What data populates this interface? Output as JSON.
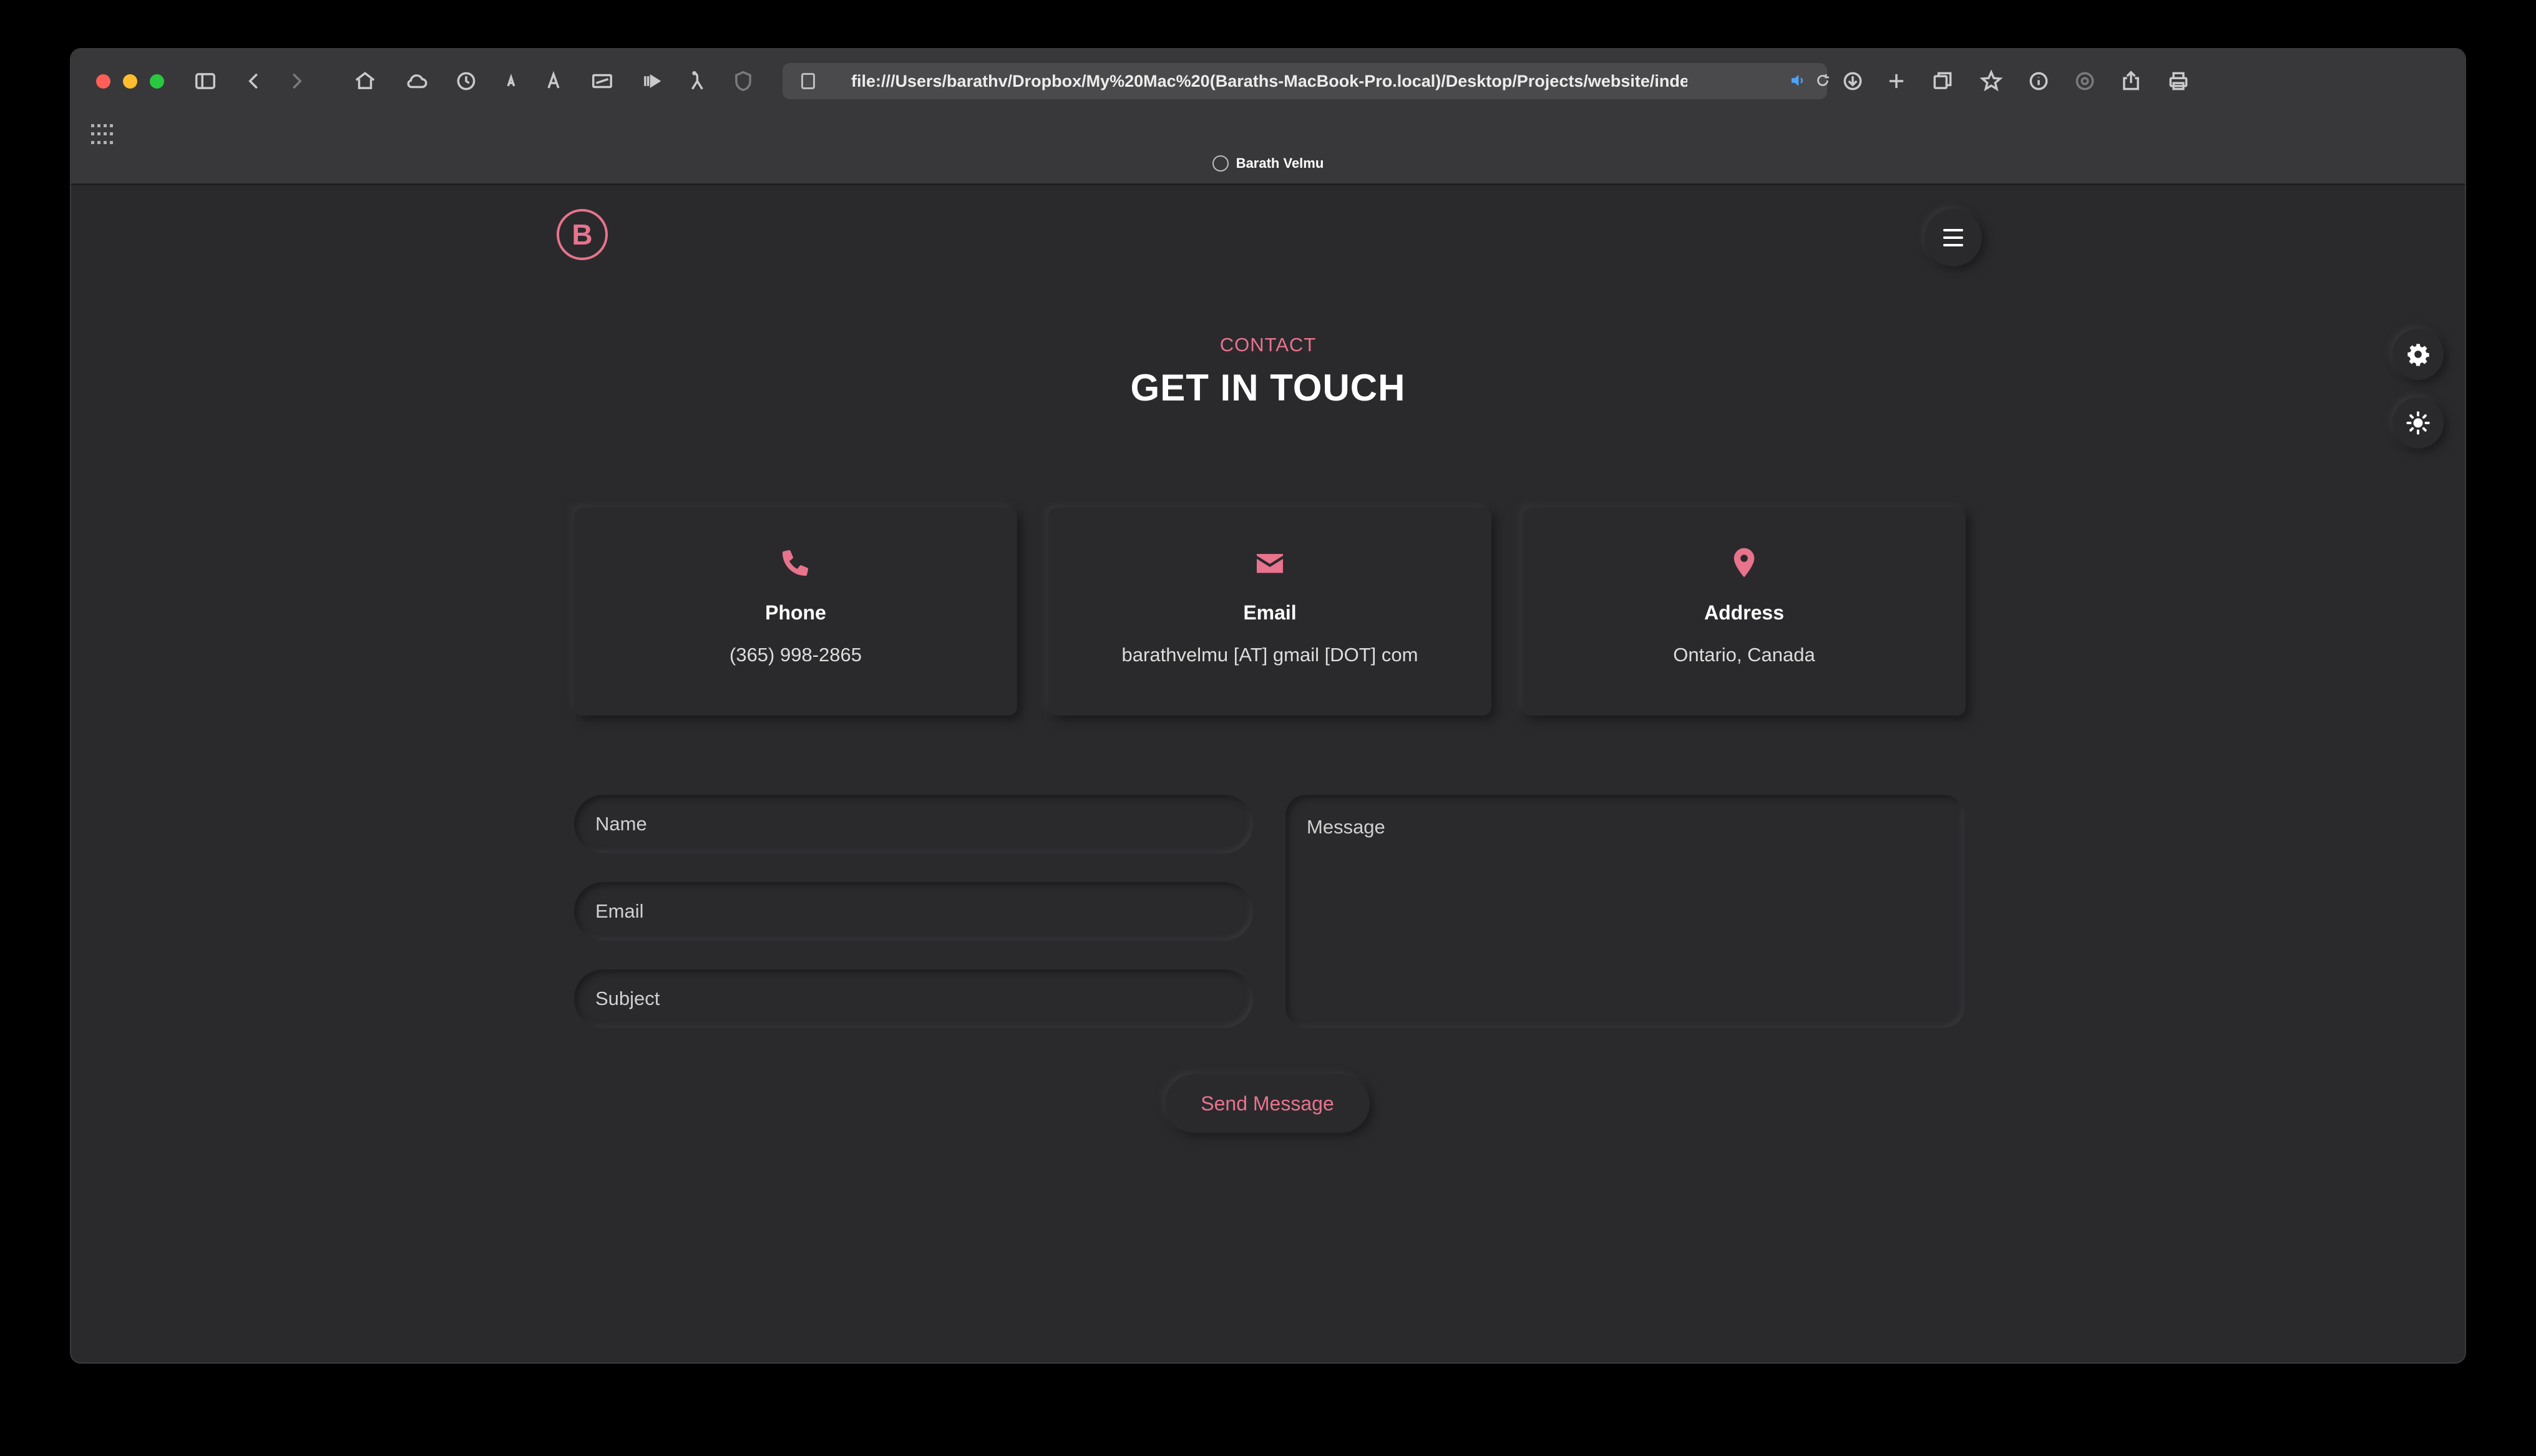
{
  "browser": {
    "url": "file:///Users/barathv/Dropbox/My%20Mac%20(Baraths-MacBook-Pro.local)/Desktop/Projects/website/index.htm",
    "tab_title": "Barath Velmu"
  },
  "header": {
    "logo_letter": "B"
  },
  "section": {
    "tag": "CONTACT",
    "title": "GET IN TOUCH"
  },
  "cards": [
    {
      "icon": "phone-icon",
      "label": "Phone",
      "value": "(365) 998-2865"
    },
    {
      "icon": "envelope-icon",
      "label": "Email",
      "value": "barathvelmu [AT] gmail [DOT] com"
    },
    {
      "icon": "map-pin-icon",
      "label": "Address",
      "value": "Ontario, Canada"
    }
  ],
  "form": {
    "name_placeholder": "Name",
    "email_placeholder": "Email",
    "subject_placeholder": "Subject",
    "message_placeholder": "Message",
    "send_label": "Send Message"
  },
  "colors": {
    "accent": "#e8738d",
    "background": "#2a2a2d",
    "text": "#ffffff"
  }
}
